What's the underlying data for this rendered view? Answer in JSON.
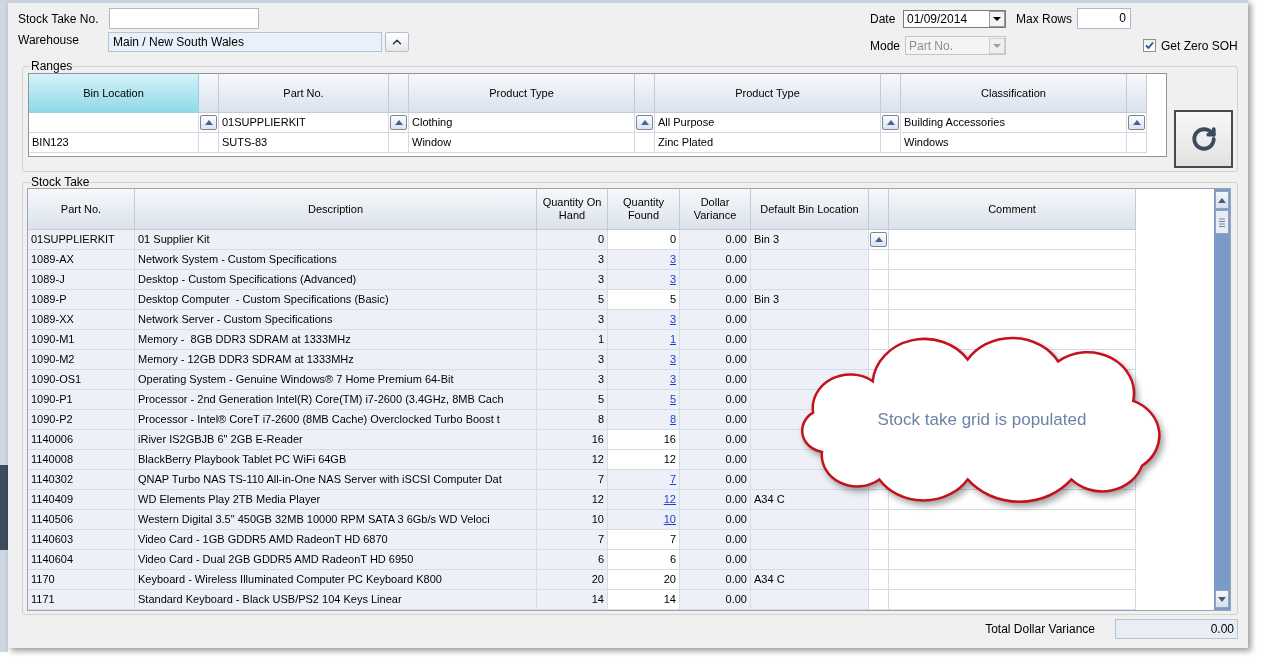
{
  "form": {
    "stock_take_no": {
      "label": "Stock Take No."
    },
    "warehouse": {
      "label": "Warehouse",
      "value": "Main / New South Wales"
    },
    "date": {
      "label": "Date",
      "value": "01/09/2014"
    },
    "max_rows": {
      "label": "Max Rows",
      "value": "0"
    },
    "mode": {
      "label": "Mode",
      "value": "Part No.",
      "disabled": true
    },
    "get_zero_soh": {
      "label": "Get Zero SOH",
      "checked": true
    }
  },
  "ranges": {
    "title": "Ranges",
    "columns": [
      {
        "label": "Bin Location",
        "selected": true
      },
      {
        "label": "Part No.",
        "selected": false
      },
      {
        "label": "Product Type",
        "selected": false
      },
      {
        "label": "Product Type",
        "selected": false
      },
      {
        "label": "Classification",
        "selected": false
      }
    ],
    "rows": [
      {
        "picker": true,
        "cells": [
          null,
          "01SUPPLIERKIT",
          "Clothing",
          "All Purpose",
          "Building Accessories"
        ]
      },
      {
        "picker": false,
        "cells": [
          "BIN123",
          "SUTS-83",
          "Window",
          "Zinc Plated",
          "Windows"
        ]
      }
    ]
  },
  "stock_take": {
    "title": "Stock Take",
    "columns": [
      "Part No.",
      "Description",
      "Quantity On Hand",
      "Quantity Found",
      "Dollar Variance",
      "Default Bin Location",
      "Comment"
    ],
    "rows": [
      {
        "kind": "entry",
        "part_no": "01SUPPLIERKIT",
        "description": "01 Supplier Kit",
        "quantity_on_hand": "0",
        "quantity_found": "0",
        "dollar_variance": "0.00",
        "default_bin_location": "Bin 3",
        "current": true
      },
      {
        "kind": "link",
        "part_no": "1089-AX",
        "description": "Network System - Custom Specifications",
        "quantity_on_hand": "3",
        "quantity_found": "3",
        "dollar_variance": "0.00",
        "current": false
      },
      {
        "kind": "link",
        "part_no": "1089-J",
        "description": "Desktop - Custom Specifications (Advanced)",
        "quantity_on_hand": "3",
        "quantity_found": "3",
        "dollar_variance": "0.00",
        "current": false
      },
      {
        "kind": "entry",
        "part_no": "1089-P",
        "description": "Desktop Computer  - Custom Specifications (Basic)",
        "quantity_on_hand": "5",
        "quantity_found": "5",
        "dollar_variance": "0.00",
        "default_bin_location": "Bin 3",
        "current": false
      },
      {
        "kind": "link",
        "part_no": "1089-XX",
        "description": "Network Server - Custom Specifications",
        "quantity_on_hand": "3",
        "quantity_found": "3",
        "dollar_variance": "0.00",
        "current": false
      },
      {
        "kind": "link",
        "part_no": "1090-M1",
        "description": "Memory -  8GB DDR3 SDRAM at 1333MHz",
        "quantity_on_hand": "1",
        "quantity_found": "1",
        "dollar_variance": "0.00",
        "current": false
      },
      {
        "kind": "link",
        "part_no": "1090-M2",
        "description": "Memory - 12GB DDR3 SDRAM at 1333MHz",
        "quantity_on_hand": "3",
        "quantity_found": "3",
        "dollar_variance": "0.00",
        "current": false
      },
      {
        "kind": "link",
        "part_no": "1090-OS1",
        "description": "Operating System - Genuine Windows® 7 Home Premium 64-Bit",
        "quantity_on_hand": "3",
        "quantity_found": "3",
        "dollar_variance": "0.00",
        "current": false
      },
      {
        "kind": "link",
        "part_no": "1090-P1",
        "description": "Processor - 2nd Generation Intel(R) Core(TM) i7-2600 (3.4GHz, 8MB Cach",
        "quantity_on_hand": "5",
        "quantity_found": "5",
        "dollar_variance": "0.00",
        "current": false
      },
      {
        "kind": "link",
        "part_no": "1090-P2",
        "description": "Processor - Intel® CoreT i7-2600 (8MB Cache) Overclocked Turbo Boost t",
        "quantity_on_hand": "8",
        "quantity_found": "8",
        "dollar_variance": "0.00",
        "current": false
      },
      {
        "kind": "entry",
        "part_no": "1140006",
        "description": "iRiver IS2GBJB 6\" 2GB E-Reader",
        "quantity_on_hand": "16",
        "quantity_found": "16",
        "dollar_variance": "0.00",
        "current": false
      },
      {
        "kind": "entry",
        "part_no": "1140008",
        "description": "BlackBerry Playbook Tablet PC WiFi 64GB",
        "quantity_on_hand": "12",
        "quantity_found": "12",
        "dollar_variance": "0.00",
        "current": false
      },
      {
        "kind": "link",
        "part_no": "1140302",
        "description": "QNAP Turbo NAS TS-110 All-in-One NAS Server with iSCSI Computer Dat",
        "quantity_on_hand": "7",
        "quantity_found": "7",
        "dollar_variance": "0.00",
        "current": false
      },
      {
        "kind": "link",
        "part_no": "1140409",
        "description": "WD Elements Play 2TB Media Player",
        "quantity_on_hand": "12",
        "quantity_found": "12",
        "dollar_variance": "0.00",
        "default_bin_location": "A34 C",
        "current": false
      },
      {
        "kind": "link",
        "part_no": "1140506",
        "description": "Western Digital 3.5\" 450GB 32MB 10000 RPM SATA 3 6Gb/s WD Veloci",
        "quantity_on_hand": "10",
        "quantity_found": "10",
        "dollar_variance": "0.00",
        "current": false
      },
      {
        "kind": "entry",
        "part_no": "1140603",
        "description": "Video Card - 1GB GDDR5 AMD RadeonT HD 6870",
        "quantity_on_hand": "7",
        "quantity_found": "7",
        "dollar_variance": "0.00",
        "current": false
      },
      {
        "kind": "entry",
        "part_no": "1140604",
        "description": "Video Card - Dual 2GB GDDR5 AMD RadeonT HD 6950",
        "quantity_on_hand": "6",
        "quantity_found": "6",
        "dollar_variance": "0.00",
        "current": false
      },
      {
        "kind": "entry",
        "part_no": "1170",
        "description": "Keyboard - Wireless Illuminated Computer PC Keyboard K800",
        "quantity_on_hand": "20",
        "quantity_found": "20",
        "dollar_variance": "0.00",
        "default_bin_location": "A34 C",
        "current": false
      },
      {
        "kind": "entry",
        "part_no": "1171",
        "description": "Standard Keyboard - Black USB/PS2 104 Keys Linear",
        "quantity_on_hand": "14",
        "quantity_found": "14",
        "dollar_variance": "0.00",
        "current": false
      }
    ]
  },
  "callout": {
    "text": "Stock take grid is populated"
  },
  "total_dollar_variance": {
    "label": "Total Dollar Variance",
    "value": "0.00"
  }
}
